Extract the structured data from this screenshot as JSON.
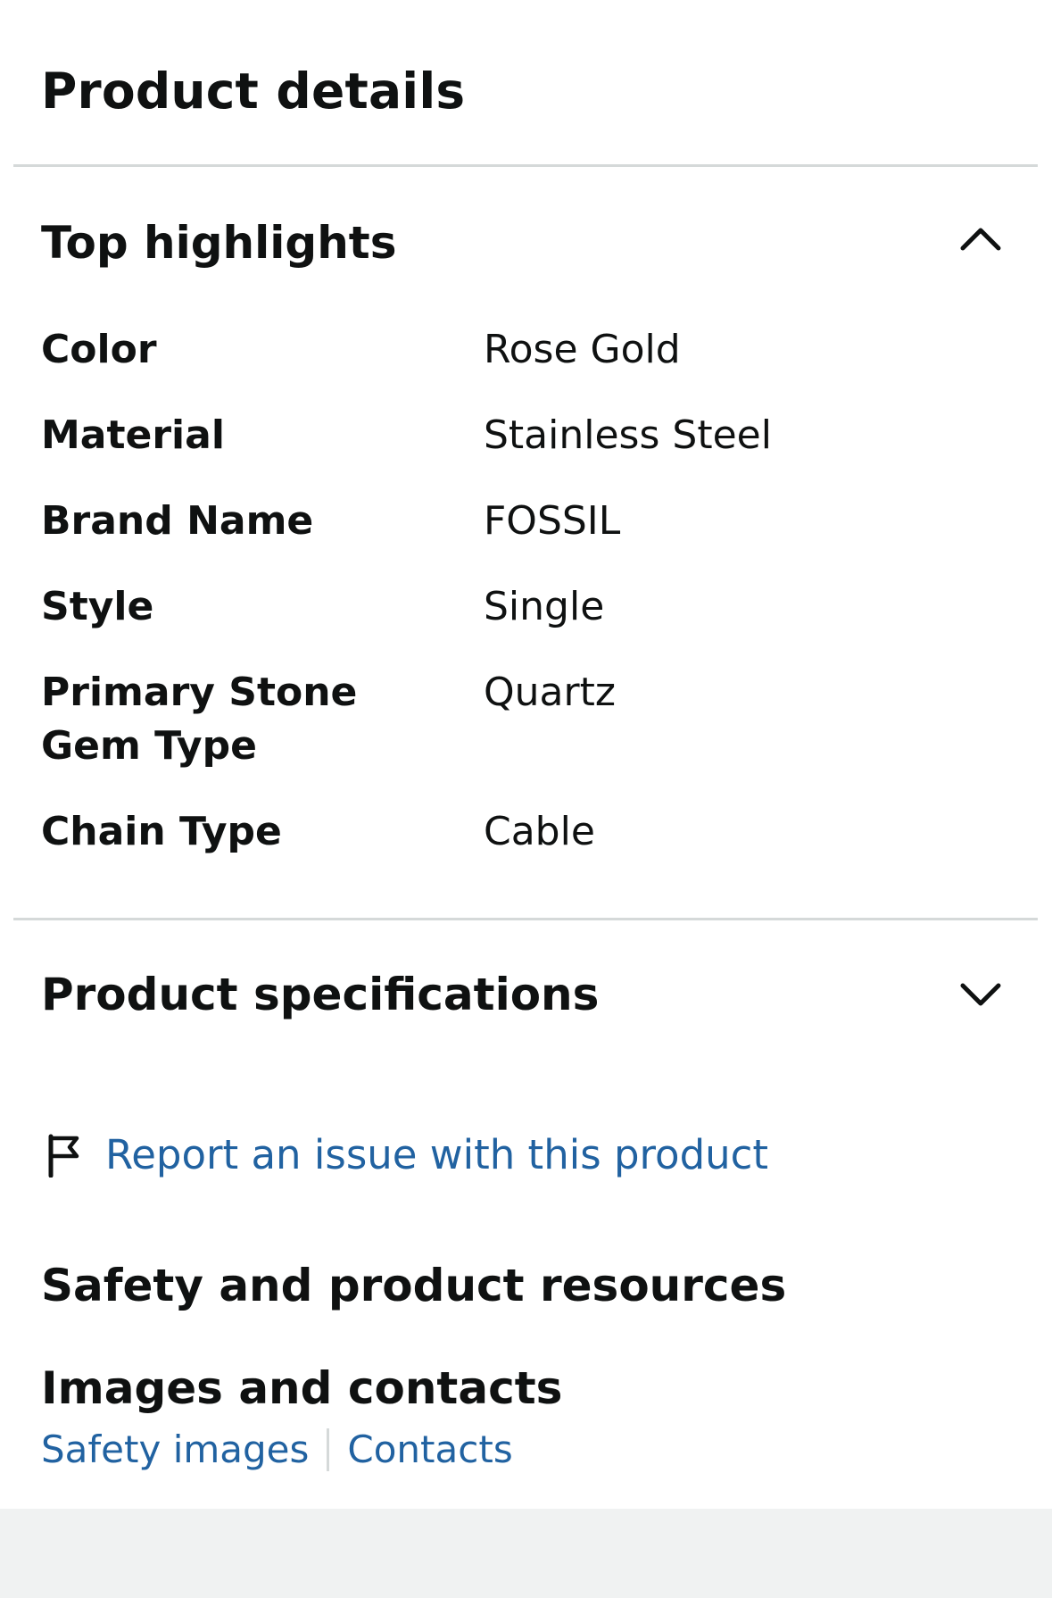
{
  "page": {
    "title": "Product details"
  },
  "top_highlights": {
    "title": "Top highlights",
    "expanded": true,
    "toggle_icon": "chevron-up-icon",
    "rows": [
      {
        "label": "Color",
        "value": "Rose Gold"
      },
      {
        "label": "Material",
        "value": "Stainless Steel"
      },
      {
        "label": "Brand Name",
        "value": "FOSSIL"
      },
      {
        "label": "Style",
        "value": "Single"
      },
      {
        "label": "Primary Stone Gem Type",
        "value": "Quartz"
      },
      {
        "label": "Chain Type",
        "value": "Cable"
      }
    ]
  },
  "product_specifications": {
    "title": "Product specifications",
    "expanded": false,
    "toggle_icon": "chevron-down-icon"
  },
  "report": {
    "icon": "flag-icon",
    "label": "Report an issue with this product"
  },
  "safety": {
    "title": "Safety and product resources"
  },
  "images_contacts": {
    "title": "Images and contacts",
    "links": [
      {
        "label": "Safety images"
      },
      {
        "label": "Contacts"
      }
    ]
  },
  "colors": {
    "text": "#0f1111",
    "link": "#2162a1",
    "divider": "#d5d9d9",
    "footer": "#f0f2f2"
  }
}
